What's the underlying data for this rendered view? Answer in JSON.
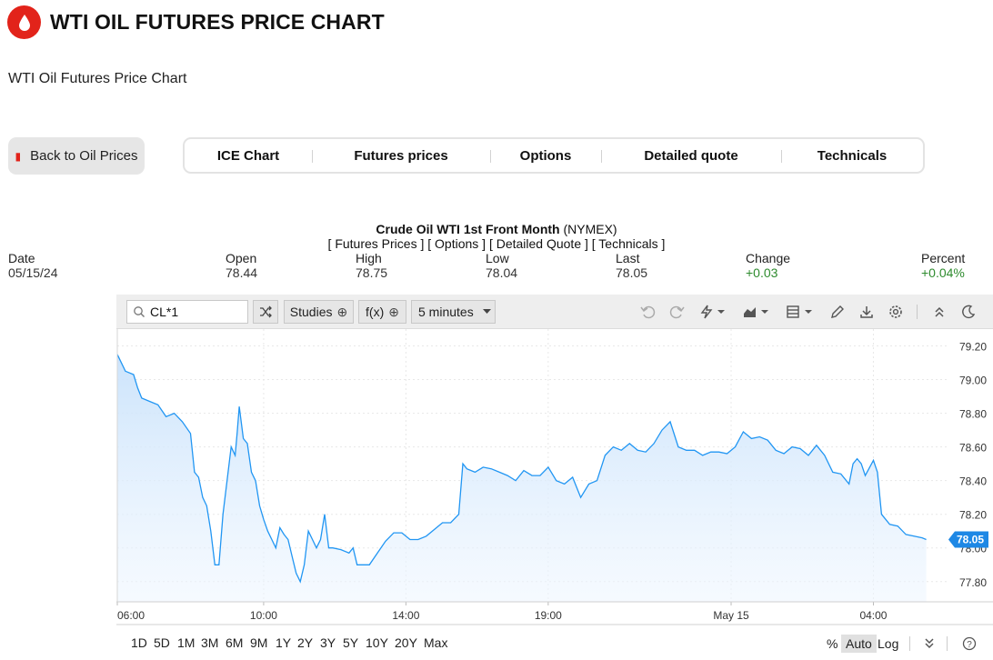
{
  "header": {
    "title": "WTI OIL FUTURES PRICE CHART",
    "subtitle": "WTI Oil Futures Price Chart"
  },
  "back_button": {
    "label": "Back to Oil Prices"
  },
  "tabs": [
    {
      "label": "ICE Chart"
    },
    {
      "label": "Futures prices"
    },
    {
      "label": "Options"
    },
    {
      "label": "Detailed quote"
    },
    {
      "label": "Technicals"
    }
  ],
  "quote": {
    "name": "Crude Oil WTI 1st Front Month",
    "exchange": "(NYMEX)",
    "links": "[ Futures Prices ] [ Options ] [ Detailed Quote ] [ Technicals ]",
    "stats": [
      {
        "label": "Date",
        "value": "05/15/24",
        "positive": false
      },
      {
        "label": "Open",
        "value": "78.44",
        "positive": false
      },
      {
        "label": "High",
        "value": "78.75",
        "positive": false
      },
      {
        "label": "Low",
        "value": "78.04",
        "positive": false
      },
      {
        "label": "Last",
        "value": "78.05",
        "positive": false
      },
      {
        "label": "Change",
        "value": "+0.03",
        "positive": true
      },
      {
        "label": "Percent",
        "value": "+0.04%",
        "positive": true
      }
    ]
  },
  "toolbar": {
    "symbol_value": "CL*1",
    "studies_label": "Studies",
    "fx_label": "f(x)",
    "interval_label": "5 minutes",
    "icons": [
      "undo-icon",
      "redo-icon",
      "lightning-icon",
      "chart-type-icon",
      "calculator-icon",
      "pencil-icon",
      "download-icon",
      "settings-icon",
      "collapse-up-icon",
      "dark-mode-icon"
    ]
  },
  "range_buttons": [
    "1D",
    "5D",
    "1M",
    "3M",
    "6M",
    "9M",
    "1Y",
    "2Y",
    "3Y",
    "5Y",
    "10Y",
    "20Y",
    "Max"
  ],
  "scale_options": [
    {
      "label": "%",
      "active": false
    },
    {
      "label": "Auto",
      "active": true
    },
    {
      "label": "Log",
      "active": false
    }
  ],
  "colors": {
    "brand": "#e2231a",
    "line": "#2196f3",
    "positive": "#2e8b2e"
  },
  "chart_data": {
    "type": "area",
    "ylim": [
      77.68,
      79.3
    ],
    "yticks": [
      79.2,
      79.0,
      78.8,
      78.6,
      78.4,
      78.2,
      78.0,
      77.8
    ],
    "ytick_labels": [
      "79.20",
      "79.00",
      "78.80",
      "78.60",
      "78.40",
      "78.20",
      "78.00",
      "77.80"
    ],
    "xlim": [
      0,
      202
    ],
    "xticks": [
      {
        "x": 0,
        "label": "06:00"
      },
      {
        "x": 36,
        "label": "10:00"
      },
      {
        "x": 71,
        "label": "14:00"
      },
      {
        "x": 106,
        "label": "19:00"
      },
      {
        "x": 151,
        "label": "May 15"
      },
      {
        "x": 186,
        "label": "04:00"
      }
    ],
    "last_price_label": "78.05",
    "last_value": 78.05,
    "grid": true,
    "series": [
      {
        "points": [
          [
            0,
            79.15
          ],
          [
            2,
            79.05
          ],
          [
            4,
            79.03
          ],
          [
            5,
            78.95
          ],
          [
            6,
            78.89
          ],
          [
            8,
            78.87
          ],
          [
            10,
            78.85
          ],
          [
            12,
            78.78
          ],
          [
            14,
            78.8
          ],
          [
            16,
            78.75
          ],
          [
            18,
            78.68
          ],
          [
            19,
            78.45
          ],
          [
            20,
            78.42
          ],
          [
            21,
            78.3
          ],
          [
            22,
            78.25
          ],
          [
            23,
            78.1
          ],
          [
            24,
            77.9
          ],
          [
            25,
            77.9
          ],
          [
            26,
            78.2
          ],
          [
            27,
            78.4
          ],
          [
            28,
            78.6
          ],
          [
            29,
            78.55
          ],
          [
            29.5,
            78.69
          ],
          [
            30,
            78.84
          ],
          [
            31,
            78.65
          ],
          [
            32,
            78.62
          ],
          [
            33,
            78.45
          ],
          [
            34,
            78.4
          ],
          [
            35,
            78.25
          ],
          [
            36,
            78.17
          ],
          [
            37,
            78.1
          ],
          [
            38,
            78.05
          ],
          [
            39,
            78.0
          ],
          [
            40,
            78.12
          ],
          [
            41,
            78.08
          ],
          [
            42,
            78.05
          ],
          [
            43,
            77.95
          ],
          [
            44,
            77.85
          ],
          [
            45,
            77.8
          ],
          [
            46,
            77.9
          ],
          [
            47,
            78.1
          ],
          [
            48,
            78.05
          ],
          [
            49,
            78.0
          ],
          [
            50,
            78.05
          ],
          [
            51,
            78.2
          ],
          [
            52,
            78.0
          ],
          [
            53,
            78.0
          ],
          [
            55,
            77.99
          ],
          [
            57,
            77.97
          ],
          [
            58,
            78.0
          ],
          [
            59,
            77.9
          ],
          [
            60,
            77.9
          ],
          [
            62,
            77.9
          ],
          [
            64,
            77.97
          ],
          [
            66,
            78.04
          ],
          [
            68,
            78.09
          ],
          [
            70,
            78.09
          ],
          [
            72,
            78.05
          ],
          [
            74,
            78.05
          ],
          [
            76,
            78.07
          ],
          [
            78,
            78.11
          ],
          [
            80,
            78.15
          ],
          [
            82,
            78.15
          ],
          [
            84,
            78.2
          ],
          [
            85,
            78.5
          ],
          [
            86,
            78.47
          ],
          [
            88,
            78.45
          ],
          [
            90,
            78.48
          ],
          [
            92,
            78.47
          ],
          [
            94,
            78.45
          ],
          [
            96,
            78.43
          ],
          [
            98,
            78.4
          ],
          [
            100,
            78.46
          ],
          [
            102,
            78.43
          ],
          [
            104,
            78.43
          ],
          [
            106,
            78.48
          ],
          [
            108,
            78.4
          ],
          [
            110,
            78.38
          ],
          [
            112,
            78.42
          ],
          [
            114,
            78.3
          ],
          [
            116,
            78.38
          ],
          [
            118,
            78.4
          ],
          [
            120,
            78.55
          ],
          [
            122,
            78.6
          ],
          [
            124,
            78.58
          ],
          [
            126,
            78.62
          ],
          [
            128,
            78.58
          ],
          [
            130,
            78.57
          ],
          [
            132,
            78.62
          ],
          [
            134,
            78.7
          ],
          [
            136,
            78.75
          ],
          [
            138,
            78.6
          ],
          [
            140,
            78.58
          ],
          [
            142,
            78.58
          ],
          [
            144,
            78.55
          ],
          [
            146,
            78.57
          ],
          [
            148,
            78.57
          ],
          [
            150,
            78.56
          ],
          [
            152,
            78.6
          ],
          [
            154,
            78.69
          ],
          [
            156,
            78.65
          ],
          [
            158,
            78.66
          ],
          [
            160,
            78.64
          ],
          [
            162,
            78.58
          ],
          [
            164,
            78.56
          ],
          [
            166,
            78.6
          ],
          [
            168,
            78.59
          ],
          [
            170,
            78.55
          ],
          [
            172,
            78.61
          ],
          [
            174,
            78.55
          ],
          [
            176,
            78.45
          ],
          [
            178,
            78.44
          ],
          [
            180,
            78.38
          ],
          [
            181,
            78.5
          ],
          [
            182,
            78.53
          ],
          [
            183,
            78.5
          ],
          [
            184,
            78.43
          ],
          [
            186,
            78.52
          ],
          [
            187,
            78.45
          ],
          [
            188,
            78.2
          ],
          [
            190,
            78.14
          ],
          [
            192,
            78.13
          ],
          [
            194,
            78.08
          ],
          [
            196,
            78.07
          ],
          [
            198,
            78.06
          ],
          [
            199,
            78.05
          ]
        ]
      }
    ]
  }
}
